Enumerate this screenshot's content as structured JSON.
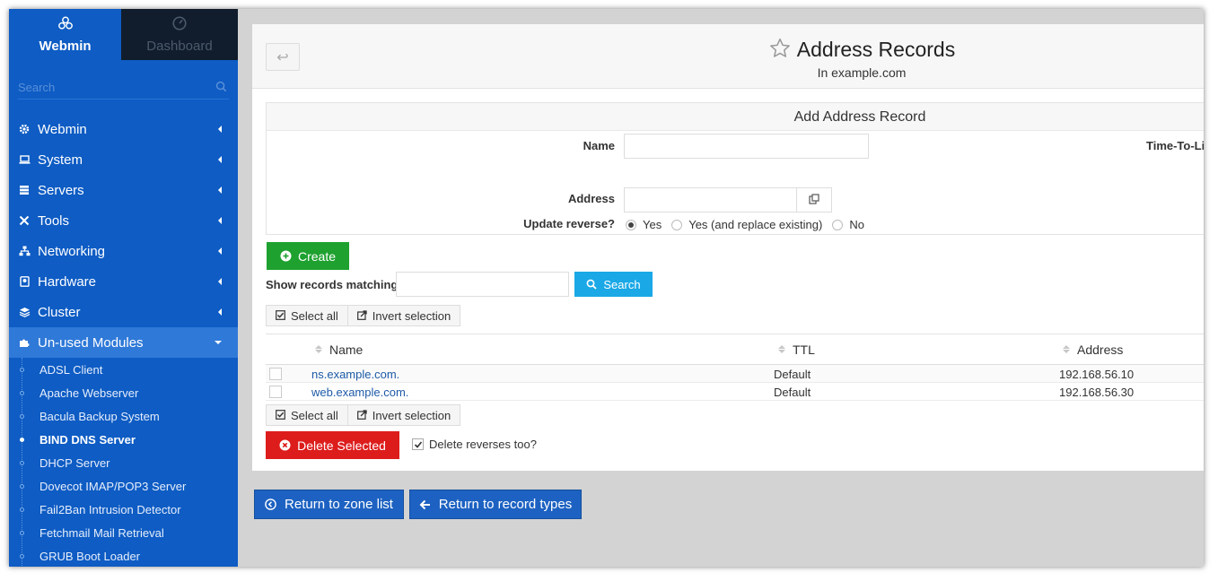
{
  "sidebar": {
    "tabs": [
      {
        "label": "Webmin",
        "icon": "webmin-logo-icon"
      },
      {
        "label": "Dashboard",
        "icon": "dashboard-gauge-icon"
      }
    ],
    "search_placeholder": "Search",
    "menu": [
      {
        "label": "Webmin",
        "icon": "gear-icon"
      },
      {
        "label": "System",
        "icon": "laptop-icon"
      },
      {
        "label": "Servers",
        "icon": "server-icon"
      },
      {
        "label": "Tools",
        "icon": "wrench-icon"
      },
      {
        "label": "Networking",
        "icon": "network-icon"
      },
      {
        "label": "Hardware",
        "icon": "hard-drive-icon"
      },
      {
        "label": "Cluster",
        "icon": "stack-icon"
      },
      {
        "label": "Un-used Modules",
        "icon": "puzzle-icon"
      }
    ],
    "submenu": [
      "ADSL Client",
      "Apache Webserver",
      "Bacula Backup System",
      "BIND DNS Server",
      "DHCP Server",
      "Dovecot IMAP/POP3 Server",
      "Fail2Ban Intrusion Detector",
      "Fetchmail Mail Retrieval",
      "GRUB Boot Loader"
    ],
    "active_submenu": "BIND DNS Server"
  },
  "header": {
    "title": "Address Records",
    "subtitle": "In example.com"
  },
  "add_form": {
    "heading": "Add Address Record",
    "name_label": "Name",
    "name_value": "",
    "ttl_label": "Time-To-Li",
    "address_label": "Address",
    "address_value": "",
    "update_reverse_label": "Update reverse?",
    "update_reverse_options": [
      "Yes",
      "Yes (and replace existing)",
      "No"
    ],
    "update_reverse_selected": "Yes"
  },
  "actions": {
    "create_label": "Create",
    "search_label": "Search",
    "show_matching_label": "Show records matching:",
    "search_value": "",
    "select_all_label": "Select all",
    "invert_selection_label": "Invert selection",
    "delete_selected_label": "Delete Selected",
    "delete_reverses_label": "Delete reverses too?",
    "delete_reverses_checked": true
  },
  "table": {
    "columns": [
      "Name",
      "TTL",
      "Address"
    ],
    "rows": [
      {
        "name": "ns.example.com.",
        "ttl": "Default",
        "address": "192.168.56.10"
      },
      {
        "name": "web.example.com.",
        "ttl": "Default",
        "address": "192.168.56.30"
      }
    ]
  },
  "footer": {
    "return_zone_label": "Return to zone list",
    "return_types_label": "Return to record types"
  },
  "colors": {
    "sidebar": "#0e5cc4",
    "create": "#1ea12f",
    "search": "#1aa8e6",
    "delete": "#dd1c1c",
    "return": "#1d62c2"
  }
}
